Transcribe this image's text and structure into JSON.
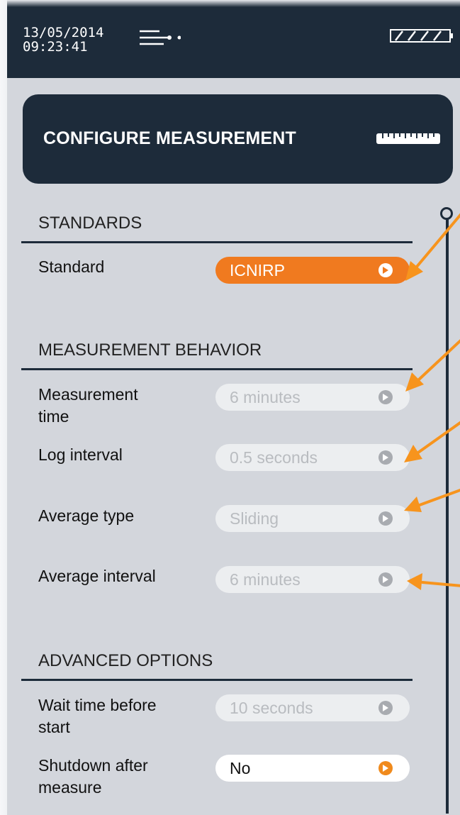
{
  "status_bar": {
    "date": "13/05/2014",
    "time": "09:23:41",
    "icons": [
      "filter-icon",
      "battery-icon"
    ]
  },
  "header": {
    "title": "CONFIGURE MEASUREMENT",
    "icon": "ruler-icon"
  },
  "sections": {
    "standards": {
      "title": "STANDARDS",
      "rows": [
        {
          "label": "Standard",
          "value": "ICNIRP"
        }
      ]
    },
    "behavior": {
      "title": "MEASUREMENT BEHAVIOR",
      "rows": [
        {
          "label_line1": "Measurement",
          "label_line2": "time",
          "value": "6 minutes"
        },
        {
          "label": "Log interval",
          "value": "0.5 seconds"
        },
        {
          "label": "Average type",
          "value": "Sliding"
        },
        {
          "label": "Average interval",
          "value": "6 minutes"
        }
      ]
    },
    "advanced": {
      "title": "ADVANCED OPTIONS",
      "rows": [
        {
          "label_line1": "Wait time before",
          "label_line2": "start",
          "value": "10 seconds"
        },
        {
          "label_line1": "Shutdown after",
          "label_line2": "measure",
          "value": "No"
        }
      ]
    }
  },
  "colors": {
    "navy": "#1d2b3a",
    "accent_orange": "#f07a1f",
    "panel_bg": "#d3d6dc",
    "annotation_arrow": "#f7941d"
  }
}
